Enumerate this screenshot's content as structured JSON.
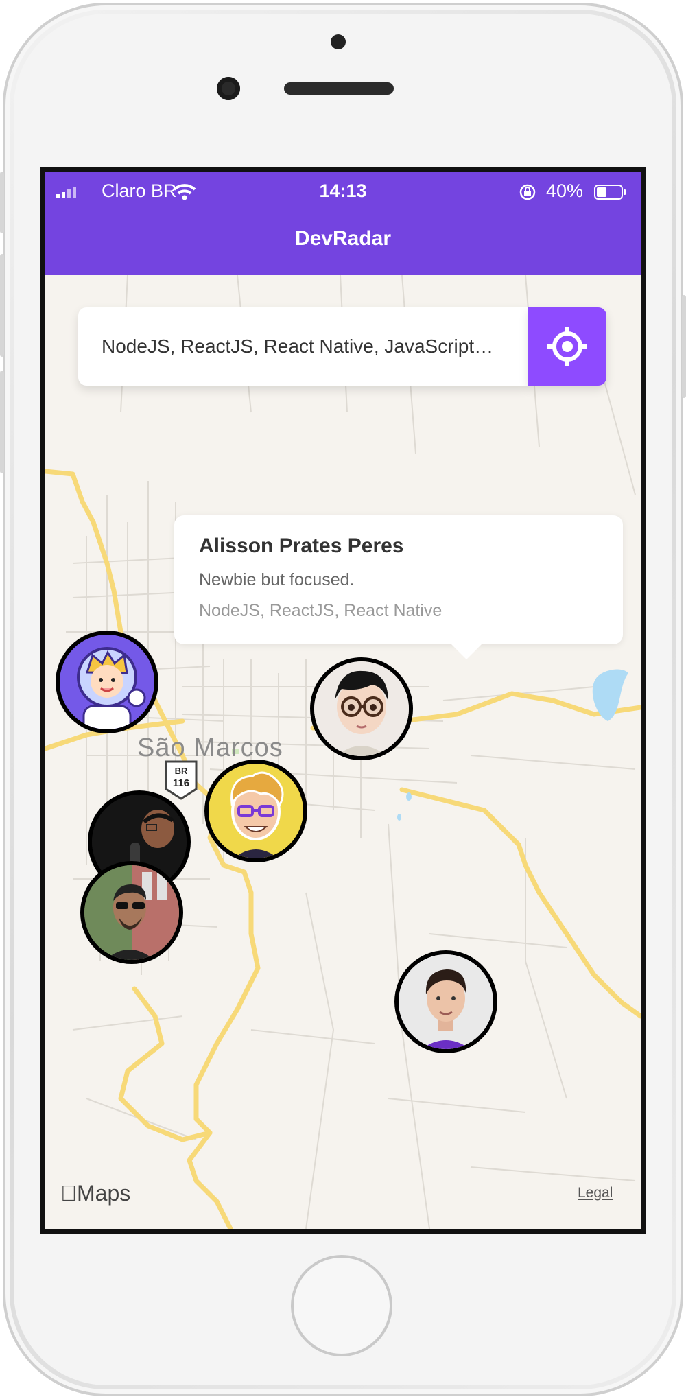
{
  "status_bar": {
    "carrier": "Claro BR",
    "time": "14:13",
    "battery": "40%"
  },
  "header": {
    "title": "DevRadar"
  },
  "search": {
    "value": "NodeJS, ReactJS, React Native, JavaScript…",
    "button_icon": "my-location-icon"
  },
  "map": {
    "place_label": "São Marcos",
    "road_shield": {
      "top": "BR",
      "number": "116"
    },
    "attribution": "Maps",
    "legal": "Legal"
  },
  "callout": {
    "name": "Alisson Prates Peres",
    "bio": "Newbie but focused.",
    "techs": "NodeJS, ReactJS, React Native"
  },
  "markers": [
    {
      "name": "astronaut-avatar"
    },
    {
      "name": "glasses-avatar"
    },
    {
      "name": "blonde-avatar"
    },
    {
      "name": "smiling-man-avatar"
    },
    {
      "name": "sunglasses-avatar"
    },
    {
      "name": "purple-shirt-avatar"
    }
  ],
  "colors": {
    "header": "#7444e0",
    "button": "#8e4bff",
    "map_bg": "#f6f3ee",
    "road": "#f6d66a"
  }
}
